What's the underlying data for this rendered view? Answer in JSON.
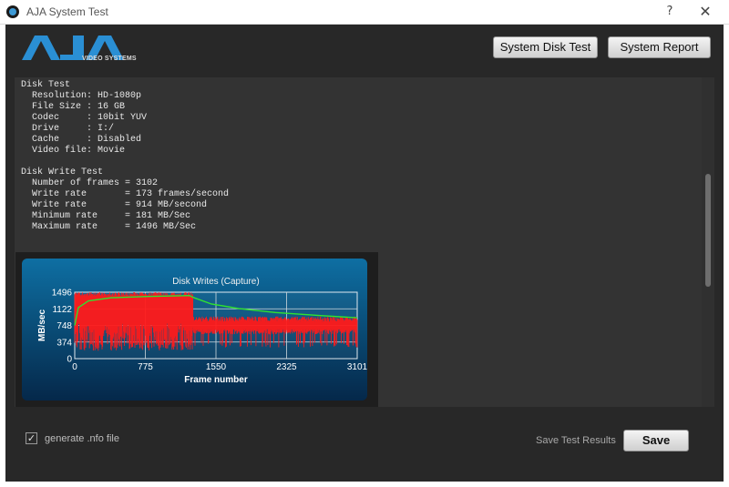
{
  "window": {
    "title": "AJA System Test",
    "help_glyph": "?",
    "close_glyph": "✕"
  },
  "logo": {
    "brand": "AJA",
    "subtitle": "VIDEO SYSTEMS",
    "color": "#2a8fd4"
  },
  "toolbar": {
    "disk_test_label": "System Disk Test",
    "report_label": "System Report"
  },
  "results": {
    "lines": [
      "Disk Test",
      "  Resolution: HD-1080p",
      "  File Size : 16 GB",
      "  Codec     : 10bit YUV",
      "  Drive     : I:/",
      "  Cache     : Disabled",
      "  Video file: Movie",
      "",
      "Disk Write Test",
      "  Number of frames = 3102",
      "  Write rate       = 173 frames/second",
      "  Write rate       = 914 MB/second",
      "  Minimum rate     = 181 MB/Sec",
      "  Maximum rate     = 1496 MB/Sec"
    ]
  },
  "chart_data": {
    "type": "line",
    "title": "Disk Writes (Capture)",
    "xlabel": "Frame number",
    "ylabel": "MB/sec",
    "xlim": [
      0,
      3101
    ],
    "ylim": [
      0,
      1496
    ],
    "x_ticks": [
      "0",
      "775",
      "1550",
      "2325",
      "3101"
    ],
    "y_ticks": [
      "0",
      "374",
      "748",
      "1122",
      "1496"
    ],
    "grid": true,
    "series": [
      {
        "color": "#ff1a1a",
        "style": "instantaneous",
        "segments": [
          {
            "x_range": [
              0,
              1300
            ],
            "min": 181,
            "max": 1496
          },
          {
            "x_range": [
              1300,
              3101
            ],
            "min": 550,
            "max": 950,
            "dips_to": 250
          }
        ]
      },
      {
        "color": "#2fe32f",
        "style": "average",
        "points": [
          [
            0,
            748
          ],
          [
            40,
            1150
          ],
          [
            150,
            1300
          ],
          [
            400,
            1370
          ],
          [
            800,
            1400
          ],
          [
            1260,
            1420
          ],
          [
            1300,
            1380
          ],
          [
            1500,
            1230
          ],
          [
            1800,
            1130
          ],
          [
            2200,
            1040
          ],
          [
            2700,
            970
          ],
          [
            3101,
            920
          ]
        ]
      }
    ]
  },
  "footer": {
    "checkbox_checked": true,
    "check_glyph": "✓",
    "nfo_label": "generate .nfo file",
    "save_results_label": "Save Test Results",
    "save_label": "Save"
  }
}
